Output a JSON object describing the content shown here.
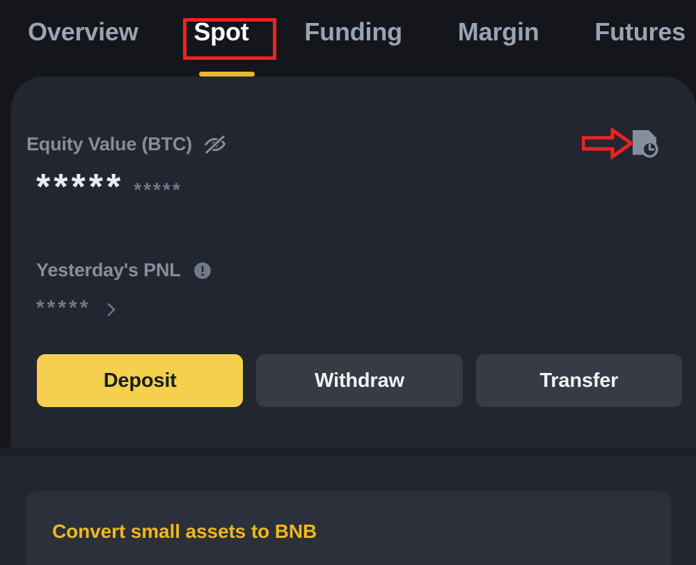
{
  "app": {
    "theme_background": "#14161c",
    "card_background": "#222630",
    "accent_gold": "#f5d04e",
    "convert_gold": "#efb81c",
    "muted_text": "#848e9c",
    "annotation_red": "#ee2222"
  },
  "tabs": [
    {
      "label": "Overview",
      "active": false
    },
    {
      "label": "Spot",
      "active": true
    },
    {
      "label": "Funding",
      "active": false
    },
    {
      "label": "Margin",
      "active": false
    },
    {
      "label": "Futures",
      "active": false
    }
  ],
  "equity": {
    "label": "Equity Value (BTC)",
    "visibility_icon": "eye-off-icon",
    "history_icon": "transaction-history-icon",
    "masked_value_major": "*****",
    "masked_value_minor": "*****"
  },
  "pnl": {
    "label": "Yesterday's PNL",
    "info_icon": "info-circle-icon",
    "masked_value": "*****",
    "chevron_icon": "chevron-right-icon"
  },
  "actions": [
    {
      "label": "Deposit",
      "style": "primary"
    },
    {
      "label": "Withdraw",
      "style": "secondary"
    },
    {
      "label": "Transfer",
      "style": "secondary"
    }
  ],
  "convert": {
    "label": "Convert small assets to BNB"
  },
  "annotations": {
    "highlight_box_target": "Spot",
    "arrow_icon": "red-arrow-right-annotation",
    "arrow_target": "transaction-history-icon"
  }
}
